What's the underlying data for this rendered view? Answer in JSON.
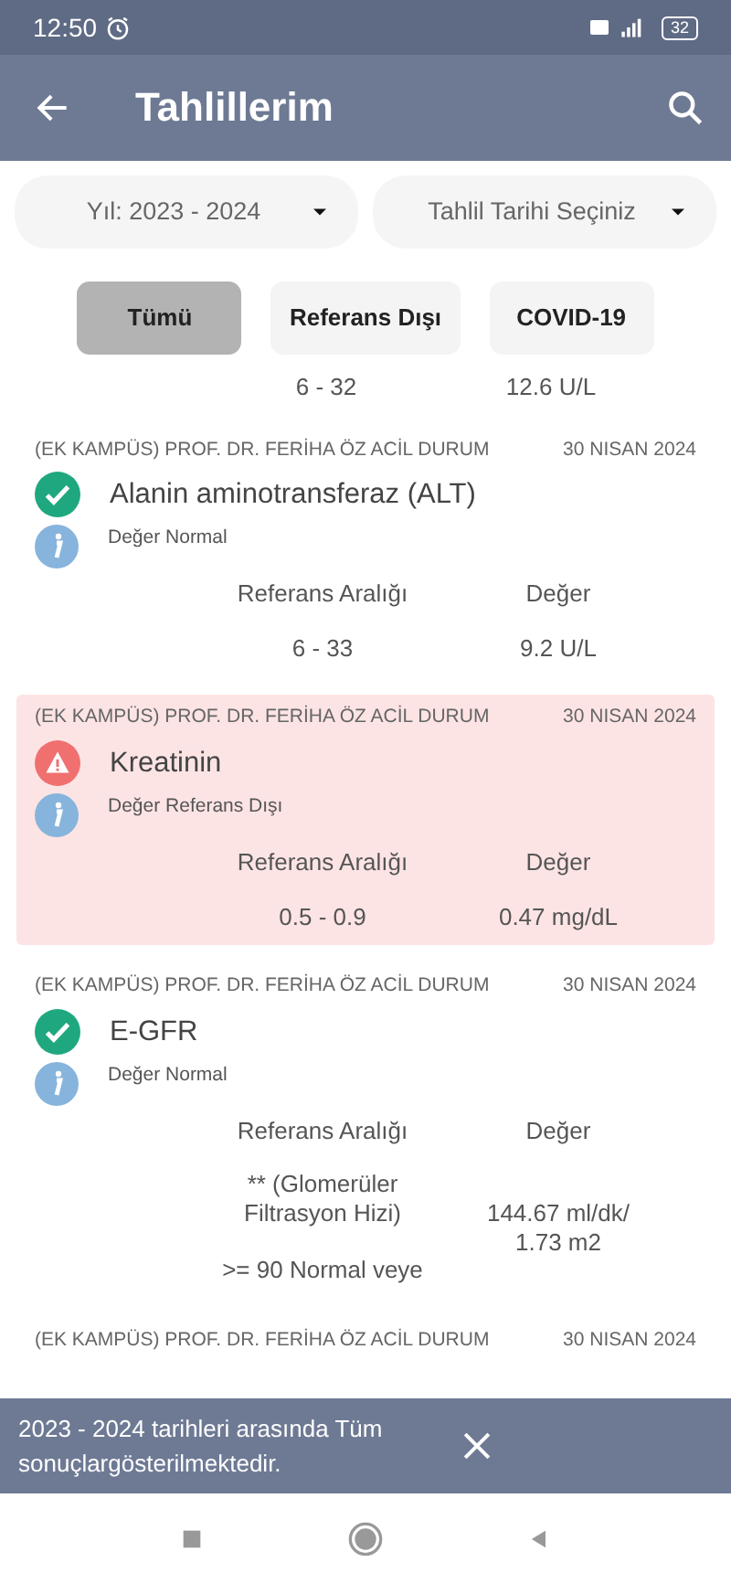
{
  "status_bar": {
    "time": "12:50",
    "battery": "32"
  },
  "app_bar": {
    "title": "Tahlillerim"
  },
  "filters": [
    {
      "label": "Yıl: 2023 - 2024"
    },
    {
      "label": "Tahlil Tarihi Seçiniz"
    }
  ],
  "tabs": [
    {
      "label": "Tümü",
      "selected": true
    },
    {
      "label": "Referans Dışı",
      "selected": false
    },
    {
      "label": "COVID-19",
      "selected": false
    }
  ],
  "partial_result": {
    "range": "6 - 32",
    "value": "12.6 U/L"
  },
  "results": [
    {
      "place": "(EK KAMPÜS) PROF. DR. FERİHA ÖZ ACİL DURUM",
      "date": "30 NISAN 2024",
      "kind": "normal",
      "name": "Alanin aminotransferaz (ALT)",
      "status": "Değer Normal",
      "range_label": "Referans Aralığı",
      "value_label": "Değer",
      "range": "6 - 33",
      "value": "9.2 U/L"
    },
    {
      "place": "(EK KAMPÜS) PROF. DR. FERİHA ÖZ ACİL DURUM",
      "date": "30 NISAN 2024",
      "kind": "out_of_range",
      "name": "Kreatinin",
      "status": "Değer Referans Dışı",
      "range_label": "Referans Aralığı",
      "value_label": "Değer",
      "range": "0.5 - 0.9",
      "value": "0.47 mg/dL"
    },
    {
      "place": "(EK KAMPÜS) PROF. DR. FERİHA ÖZ ACİL DURUM",
      "date": "30 NISAN 2024",
      "kind": "normal",
      "name": "E-GFR",
      "status": "Değer Normal",
      "range_label": "Referans Aralığı",
      "value_label": "Değer",
      "range": "** (Glomerüler Filtrasyon Hizi)\n\n>= 90 Normal veye",
      "value": "144.67 ml/dk/ 1.73 m2"
    },
    {
      "place": "(EK KAMPÜS) PROF. DR. FERİHA ÖZ ACİL DURUM",
      "date": "30 NISAN 2024",
      "kind": "header_only"
    }
  ],
  "snackbar": {
    "message": "2023 - 2024 tarihleri arasında Tüm sonuçlargösterilmektedir."
  }
}
